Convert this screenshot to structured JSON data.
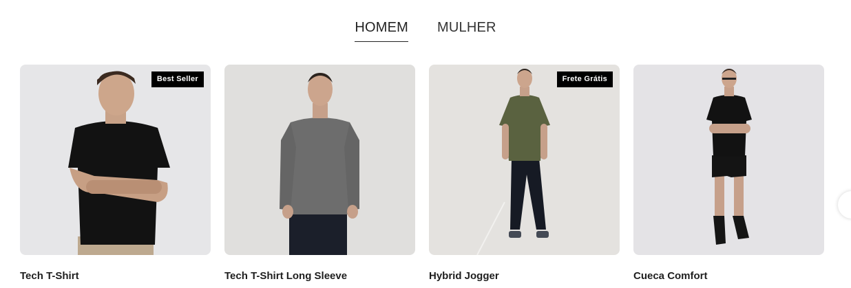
{
  "tabs": [
    {
      "label": "HOMEM",
      "active": true
    },
    {
      "label": "MULHER",
      "active": false
    }
  ],
  "products": [
    {
      "title": "Tech T-Shirt",
      "badge": "Best Seller",
      "bg": "#e6e6e6",
      "shirt": "#111111",
      "pants": "#bda98f",
      "image": "man-black-tshirt"
    },
    {
      "title": "Tech T-Shirt Long Sleeve",
      "badge": "",
      "bg": "#e0dfdd",
      "shirt": "#6b6b6b",
      "pants": "#1b1f2a",
      "image": "man-grey-longsleeve"
    },
    {
      "title": "Hybrid Jogger",
      "badge": "Frete Grátis",
      "bg": "#e4e2df",
      "shirt": "#59613f",
      "pants": "#161a24",
      "image": "man-olive-tee-jogger"
    },
    {
      "title": "Cueca Comfort",
      "badge": "",
      "bg": "#e4e3e6",
      "shirt": "#111111",
      "pants": "#111111",
      "image": "man-underwear"
    }
  ],
  "carousel": {
    "next_icon": "chevron-right-icon"
  }
}
